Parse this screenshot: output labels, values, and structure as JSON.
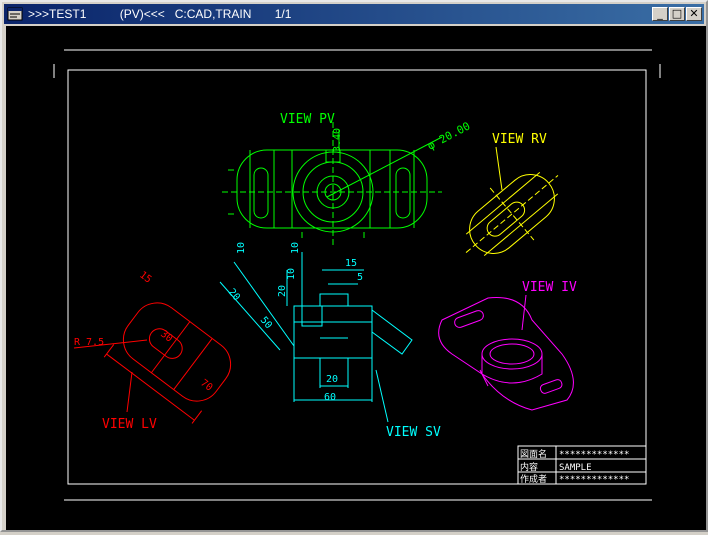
{
  "window": {
    "title": ">>>TEST1          (PV)<<<   C:CAD,TRAIN       1/1",
    "minimize_glyph": "_",
    "maximize_glyph": "□",
    "close_glyph": "✕"
  },
  "drawing": {
    "views": {
      "pv": "VIEW PV",
      "rv": "VIEW RV",
      "iv": "VIEW IV",
      "lv": "VIEW LV",
      "sv": "VIEW SV"
    },
    "dims": {
      "pv_small": "3.40",
      "pv_diameter": "φ 20.00",
      "lv_15": "15",
      "lv_r": "R 7.5",
      "lv_30": "30",
      "lv_70": "70",
      "sv_10a": "10",
      "sv_10b": "10",
      "sv_20a": "20",
      "sv_20b": "20",
      "sv_50": "50",
      "sv_15": "15",
      "sv_5": "5",
      "sv_20c": "20",
      "sv_60": "60"
    },
    "title_block": {
      "r1_label": "図面名",
      "r1_value": "*************",
      "r2_label": "内容",
      "r2_value": "SAMPLE",
      "r3_label": "作成者",
      "r3_value": "*************"
    }
  }
}
